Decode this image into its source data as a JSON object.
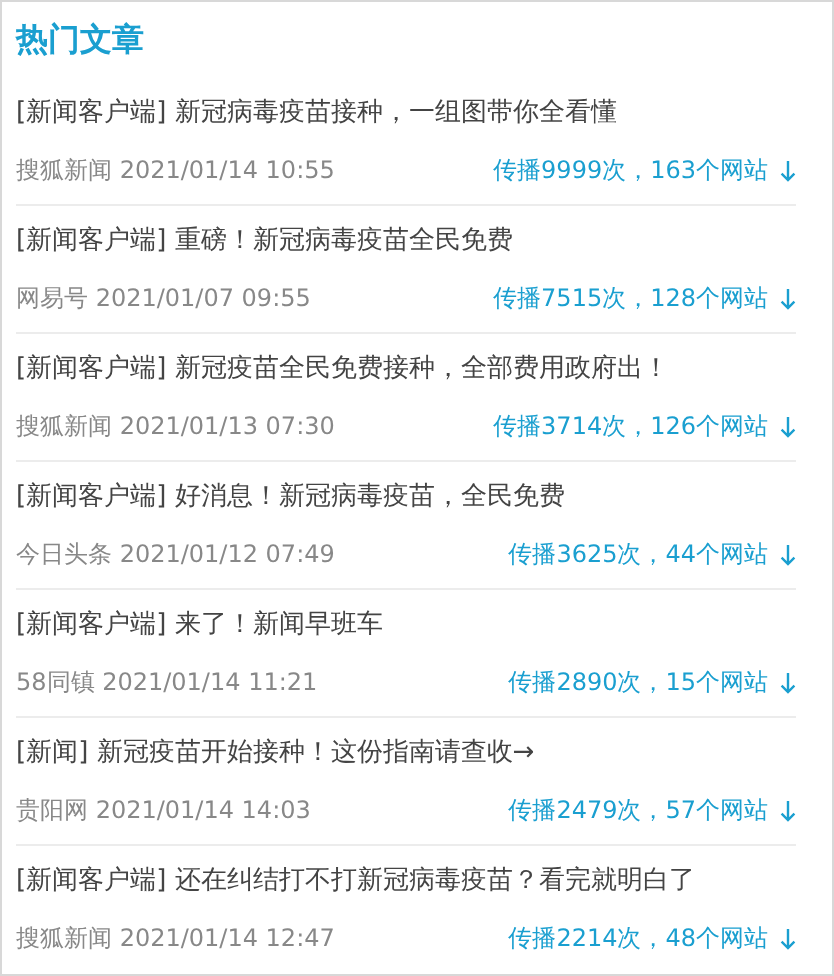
{
  "title": "热门文章",
  "articles": [
    {
      "headline": "[新闻客户端] 新冠病毒疫苗接种，一组图带你全看懂",
      "source": "搜狐新闻 2021/01/14 10:55",
      "spread": "传播9999次，163个网站"
    },
    {
      "headline": "[新闻客户端] 重磅！新冠病毒疫苗全民免费",
      "source": "网易号 2021/01/07 09:55",
      "spread": "传播7515次，128个网站"
    },
    {
      "headline": "[新闻客户端] 新冠疫苗全民免费接种，全部费用政府出！",
      "source": "搜狐新闻 2021/01/13 07:30",
      "spread": "传播3714次，126个网站"
    },
    {
      "headline": "[新闻客户端] 好消息！新冠病毒疫苗，全民免费",
      "source": "今日头条 2021/01/12 07:49",
      "spread": "传播3625次，44个网站"
    },
    {
      "headline": "[新闻客户端] 来了！新闻早班车",
      "source": "58同镇 2021/01/14 11:21",
      "spread": "传播2890次，15个网站"
    },
    {
      "headline": "[新闻] 新冠疫苗开始接种！这份指南请查收→",
      "source": "贵阳网 2021/01/14 14:03",
      "spread": "传播2479次，57个网站"
    },
    {
      "headline": "[新闻客户端] 还在纠结打不打新冠病毒疫苗？看完就明白了",
      "source": "搜狐新闻 2021/01/14 12:47",
      "spread": "传播2214次，48个网站"
    }
  ]
}
